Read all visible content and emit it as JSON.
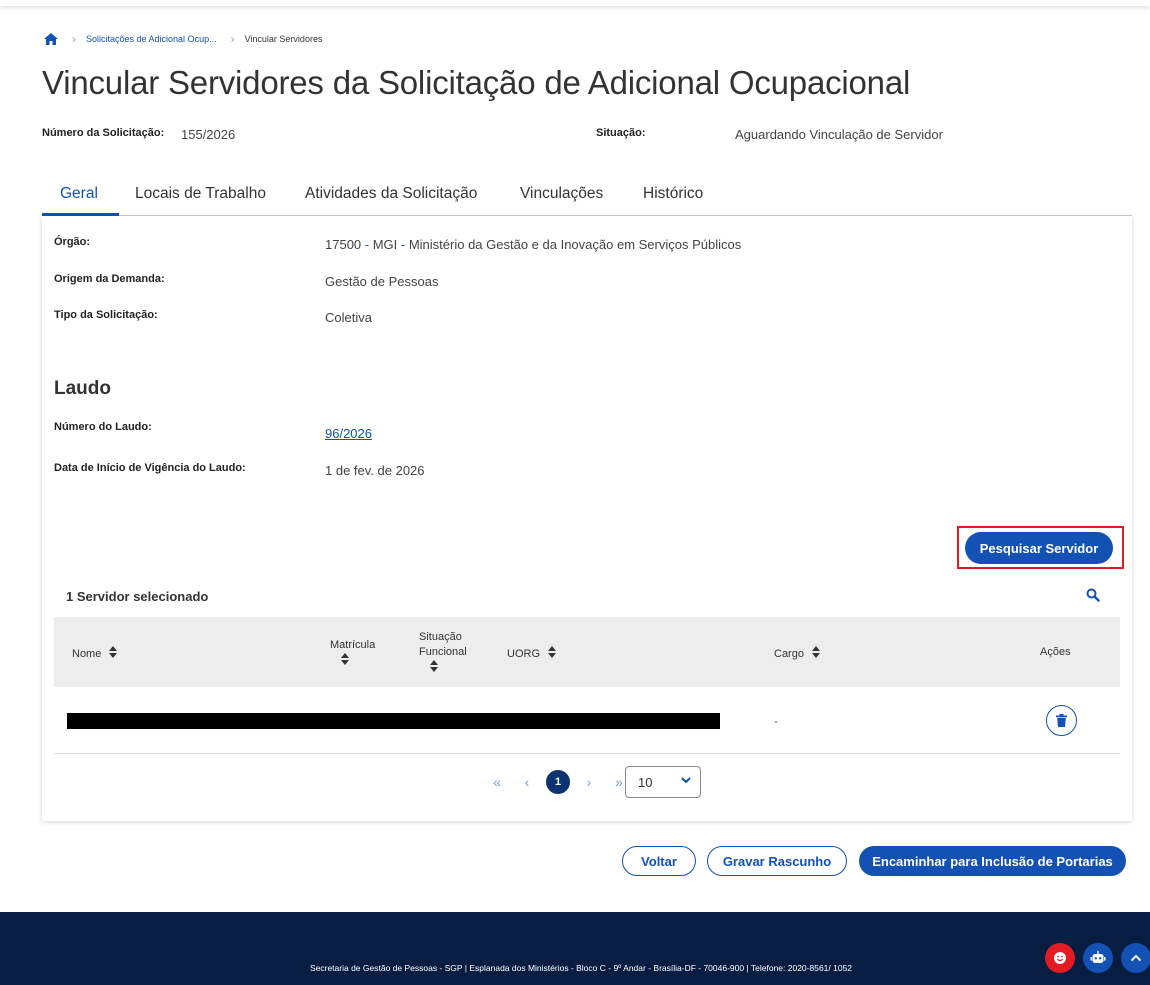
{
  "breadcrumb": {
    "home_icon": "home-icon",
    "items": [
      "Solicitações de Adicional Ocup...",
      "Vincular Servidores"
    ]
  },
  "page": {
    "title": "Vincular Servidores da Solicitação de Adicional Ocupacional"
  },
  "meta": {
    "numero_label": "Número da Solicitação:",
    "numero_value": "155/2026",
    "situacao_label": "Situação:",
    "situacao_value": "Aguardando Vinculação de Servidor"
  },
  "tabs": [
    {
      "label": "Geral",
      "active": true
    },
    {
      "label": "Locais de Trabalho",
      "active": false
    },
    {
      "label": "Atividades da Solicitação",
      "active": false
    },
    {
      "label": "Vinculações",
      "active": false
    },
    {
      "label": "Histórico",
      "active": false
    }
  ],
  "geral": {
    "orgao_label": "Órgão:",
    "orgao_code": "17500",
    "orgao_sep1": " - ",
    "orgao_sigla": "MGI",
    "orgao_sep2": " - ",
    "orgao_nome": "Ministério da Gestão e da Inovação em Serviços Públicos",
    "origem_label": "Origem da Demanda:",
    "origem_value": "Gestão de Pessoas",
    "tipo_label": "Tipo da Solicitação:",
    "tipo_value": "Coletiva"
  },
  "laudo": {
    "section_title": "Laudo",
    "numero_label": "Número do Laudo:",
    "numero_value": "96/2026",
    "data_label": "Data de Início de Vigência do Laudo:",
    "data_value": "1 de fev. de 2026"
  },
  "actions": {
    "pesquisar": "Pesquisar Servidor"
  },
  "table": {
    "caption": "1 Servidor selecionado",
    "columns": {
      "nome": "Nome",
      "matricula": "Matrícula",
      "situacao_l1": "Situação",
      "situacao_l2": "Funcional",
      "uorg": "UORG",
      "cargo": "Cargo",
      "acoes": "Ações"
    },
    "rows": [
      {
        "nome": "[redacted]",
        "cargo": "-"
      }
    ]
  },
  "pagination": {
    "first": "«",
    "prev": "‹",
    "current": "1",
    "next": "›",
    "last": "»",
    "page_size": "10"
  },
  "footer_buttons": {
    "voltar": "Voltar",
    "gravar": "Gravar Rascunho",
    "encaminhar": "Encaminhar para Inclusão de Portarias"
  },
  "footer": {
    "text": "Secretaria de Gestão de Pessoas - SGP | Esplanada dos Ministérios - Bloco C - 9º Andar - Brasília-DF - 70046-900 | Telefone: 2020-8561/ 1052"
  },
  "colors": {
    "primary": "#1351b4",
    "dark_navy": "#071d41",
    "highlight": "#e31b23",
    "feedback_fab": "#e31b23"
  }
}
